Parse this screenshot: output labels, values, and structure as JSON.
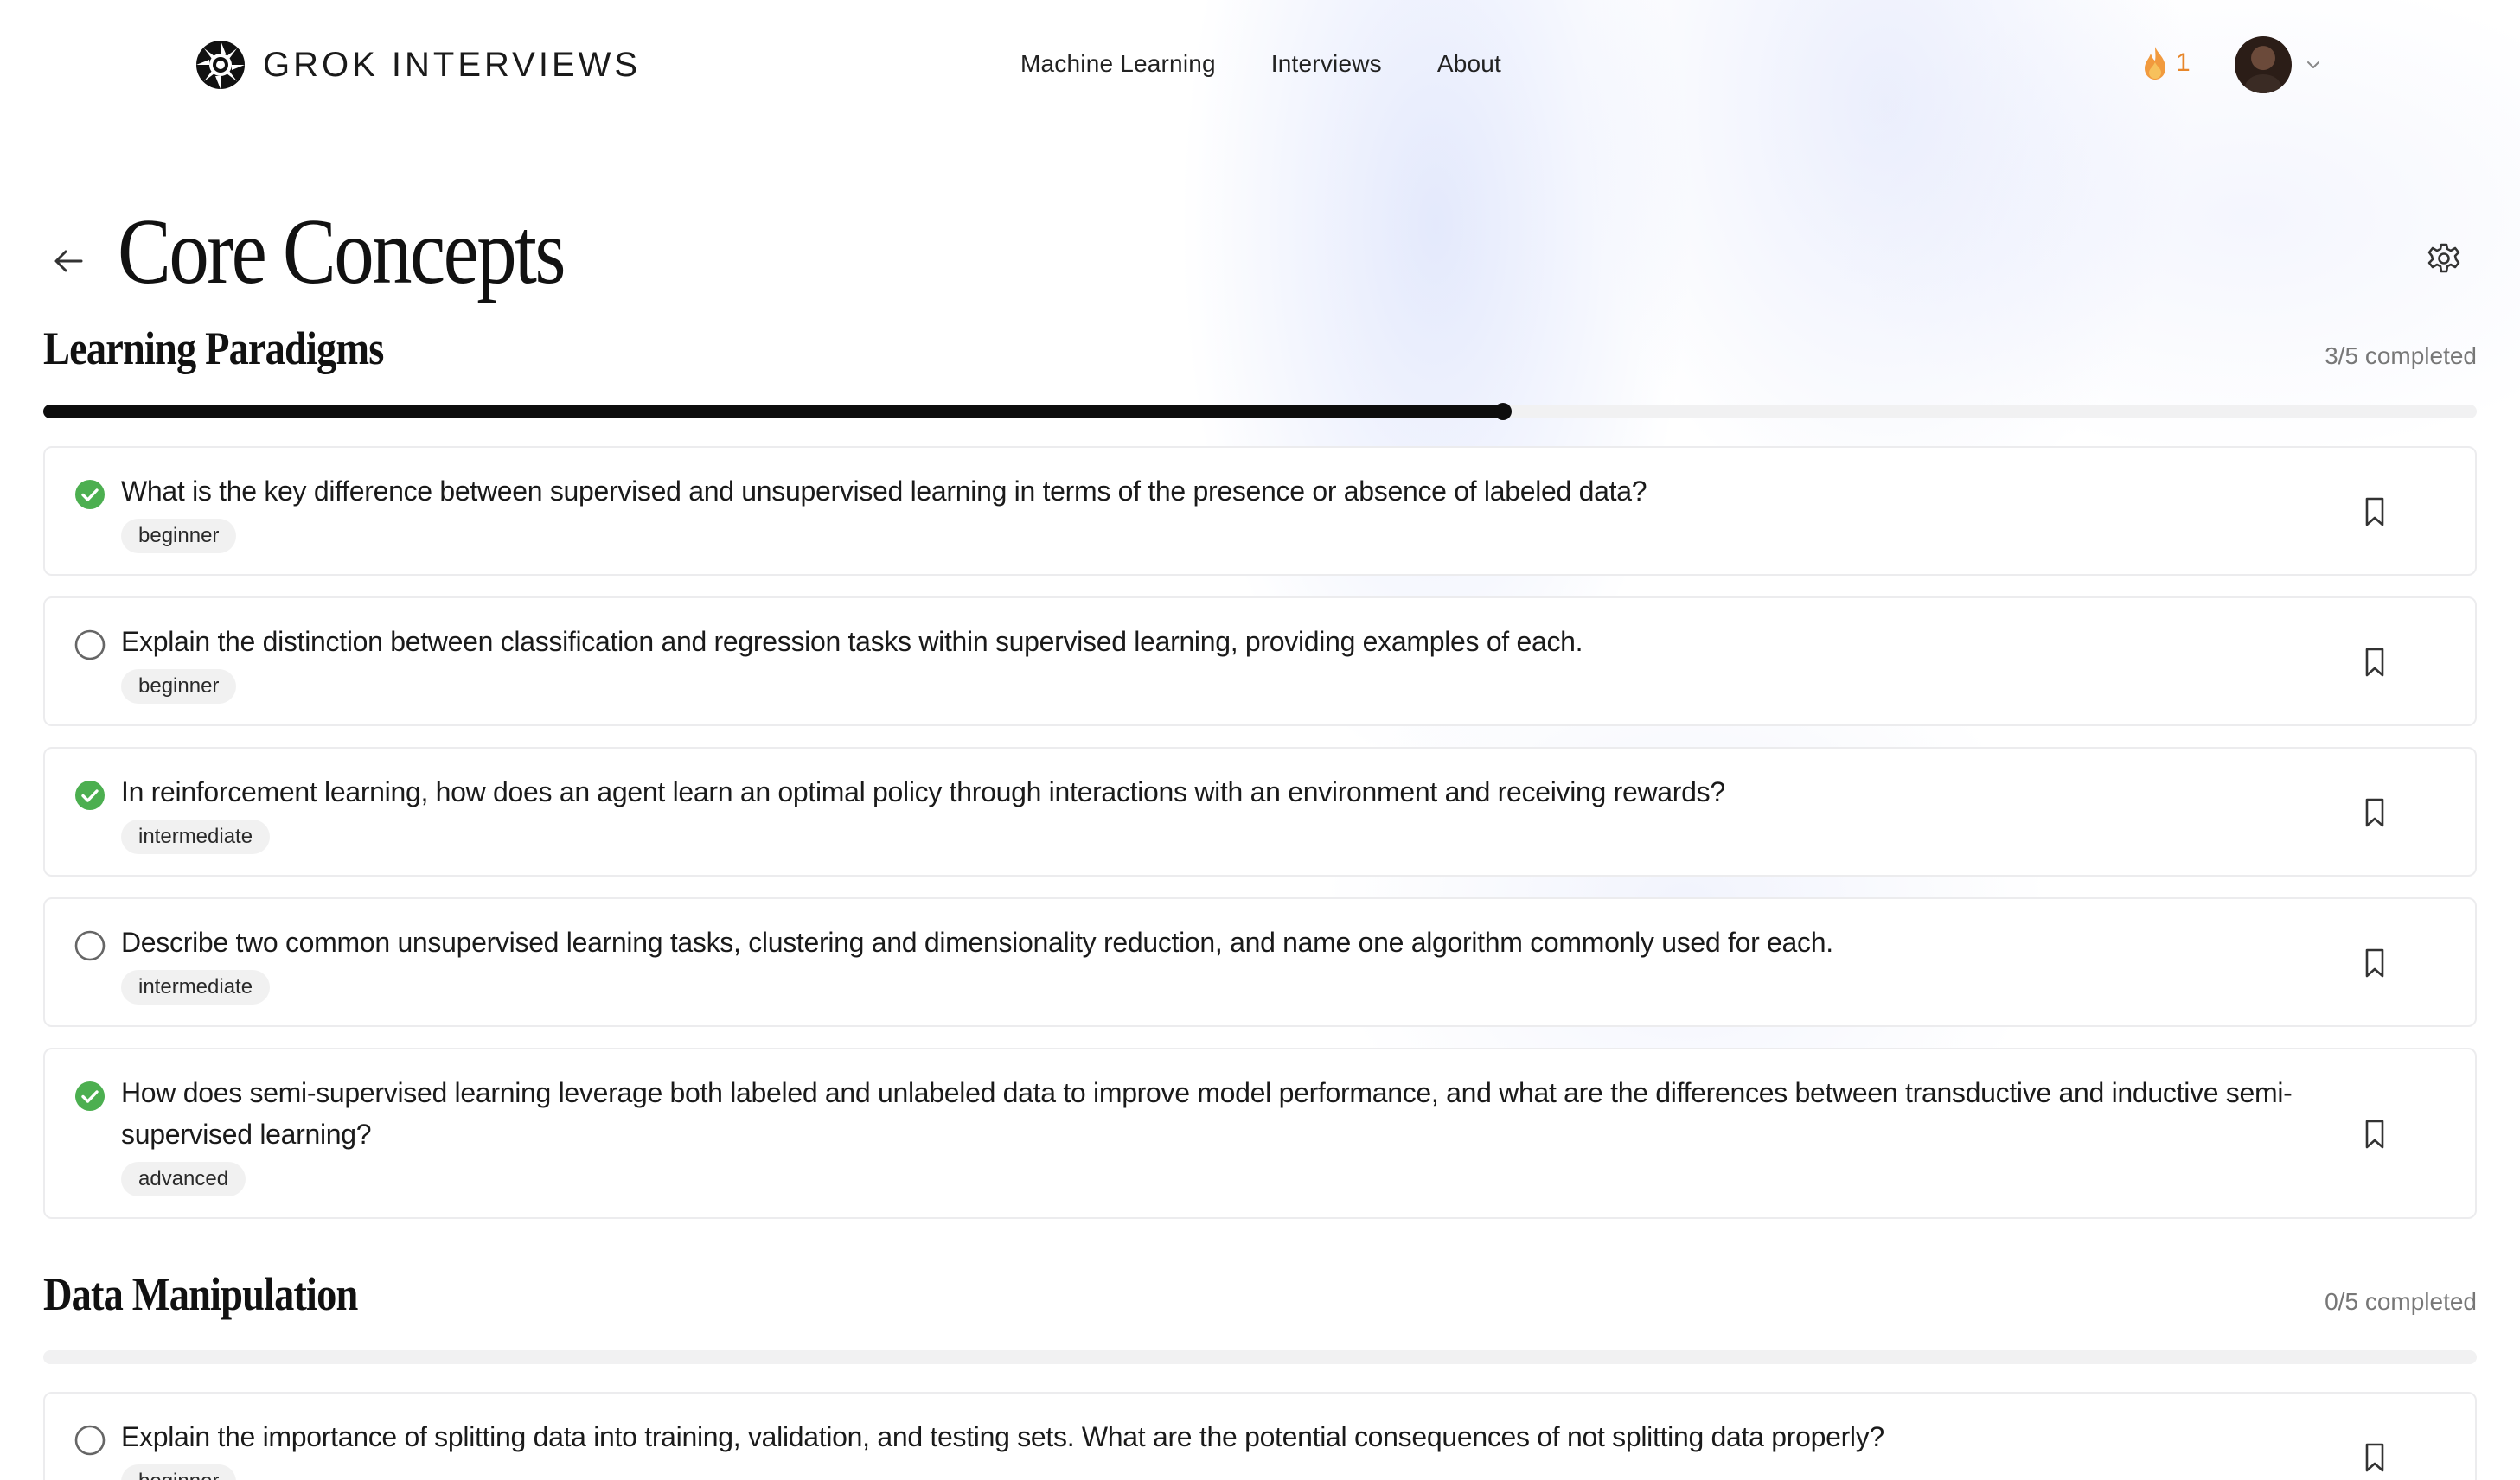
{
  "header": {
    "brand": "GROK INTERVIEWS",
    "nav": [
      "Machine Learning",
      "Interviews",
      "About"
    ],
    "streak_count": "1"
  },
  "page": {
    "title": "Core Concepts"
  },
  "sections": [
    {
      "title": "Learning Paradigms",
      "completed_label": "3/5 completed",
      "progress_fraction": 0.6,
      "questions": [
        {
          "text": "What is the key difference between supervised and unsupervised learning in terms of the presence or absence of labeled data?",
          "level": "beginner",
          "done": true
        },
        {
          "text": "Explain the distinction between classification and regression tasks within supervised learning, providing examples of each.",
          "level": "beginner",
          "done": false
        },
        {
          "text": "In reinforcement learning, how does an agent learn an optimal policy through interactions with an environment and receiving rewards?",
          "level": "intermediate",
          "done": true
        },
        {
          "text": "Describe two common unsupervised learning tasks, clustering and dimensionality reduction, and name one algorithm commonly used for each.",
          "level": "intermediate",
          "done": false
        },
        {
          "text": "How does semi-supervised learning leverage both labeled and unlabeled data to improve model performance, and what are the differences between transductive and inductive semi-supervised learning?",
          "level": "advanced",
          "done": true
        }
      ]
    },
    {
      "title": "Data Manipulation",
      "completed_label": "0/5 completed",
      "progress_fraction": 0,
      "questions": [
        {
          "text": "Explain the importance of splitting data into training, validation, and testing sets. What are the potential consequences of not splitting data properly?",
          "level": "beginner",
          "done": false
        }
      ]
    }
  ],
  "colors": {
    "done_green": "#4caf50",
    "progress_fill": "#0d0d0d",
    "streak_orange": "#e7862a"
  },
  "icons": {
    "back": "arrow-left-icon",
    "settings": "gear-icon",
    "status_done": "check-circle-icon",
    "status_todo": "empty-circle-icon",
    "bookmark": "bookmark-icon",
    "streak": "flame-icon"
  }
}
